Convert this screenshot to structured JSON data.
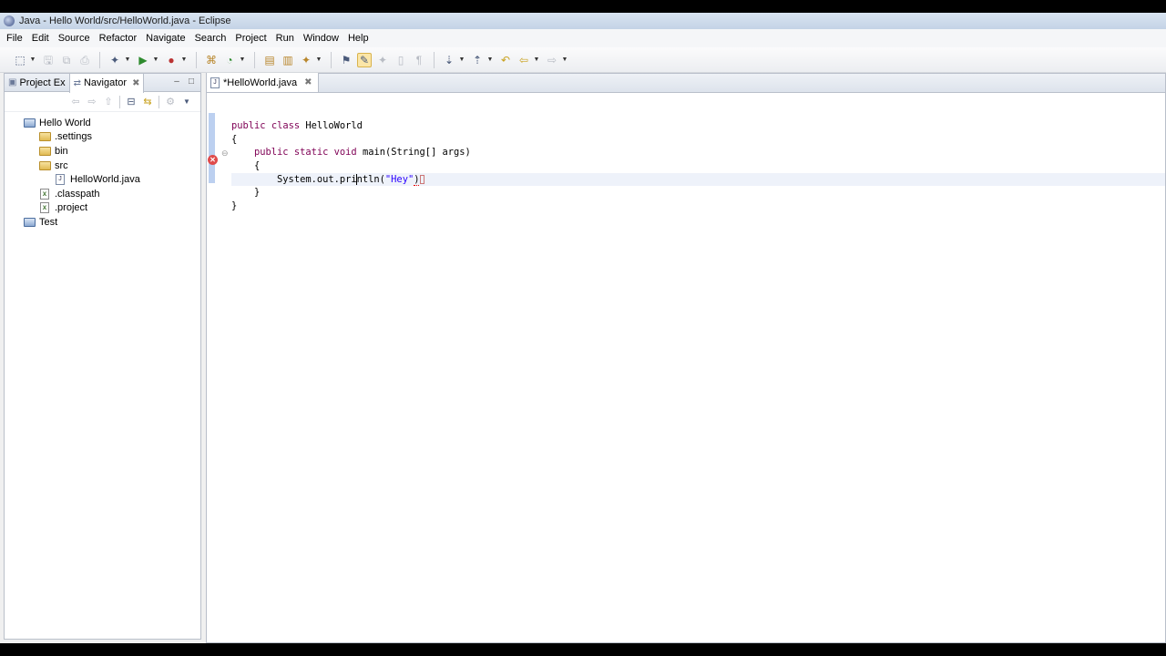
{
  "window": {
    "title": "Java - Hello World/src/HelloWorld.java - Eclipse"
  },
  "menu": {
    "items": [
      {
        "label": "File"
      },
      {
        "label": "Edit"
      },
      {
        "label": "Source"
      },
      {
        "label": "Refactor"
      },
      {
        "label": "Navigate"
      },
      {
        "label": "Search"
      },
      {
        "label": "Project"
      },
      {
        "label": "Run"
      },
      {
        "label": "Window"
      },
      {
        "label": "Help"
      }
    ]
  },
  "toolbar": {
    "icons": [
      "new-icon",
      "save-icon",
      "save-all-icon",
      "print-icon",
      "debug-icon",
      "run-icon",
      "external-tools-icon",
      "new-java-project-icon",
      "new-class-icon",
      "open-type-icon",
      "search-icon",
      "next-annotation-icon",
      "previous-annotation-icon",
      "back-icon",
      "forward-icon"
    ]
  },
  "left_panel": {
    "tabs": [
      {
        "label": "Project Ex",
        "active": false
      },
      {
        "label": "Navigator",
        "active": true
      }
    ],
    "tree": [
      {
        "label": "Hello World",
        "type": "project",
        "depth": 0
      },
      {
        "label": ".settings",
        "type": "folder",
        "depth": 1
      },
      {
        "label": "bin",
        "type": "folder",
        "depth": 1
      },
      {
        "label": "src",
        "type": "folder",
        "depth": 1
      },
      {
        "label": "HelloWorld.java",
        "type": "java",
        "depth": 2
      },
      {
        "label": ".classpath",
        "type": "xml",
        "depth": 1
      },
      {
        "label": ".project",
        "type": "xml",
        "depth": 1
      },
      {
        "label": "Test",
        "type": "project",
        "depth": 0
      }
    ]
  },
  "editor": {
    "tab_label": "*HelloWorld.java",
    "code": {
      "line1": {
        "kw1": "public",
        "kw2": "class",
        "rest": " HelloWorld"
      },
      "line2": "{",
      "line3": {
        "kw1": "public",
        "kw2": "static",
        "kw3": "void",
        "rest": " main(String[] args)"
      },
      "line4": "{",
      "line5": {
        "before_caret": "System.out.pri",
        "after_caret": "ntln(",
        "str": "\"Hey\"",
        "close": ")"
      },
      "line6": "}",
      "line7": "}"
    }
  },
  "colors": {
    "keyword": "#7f0055",
    "string": "#2a00ff",
    "error": "#e04b4b"
  }
}
